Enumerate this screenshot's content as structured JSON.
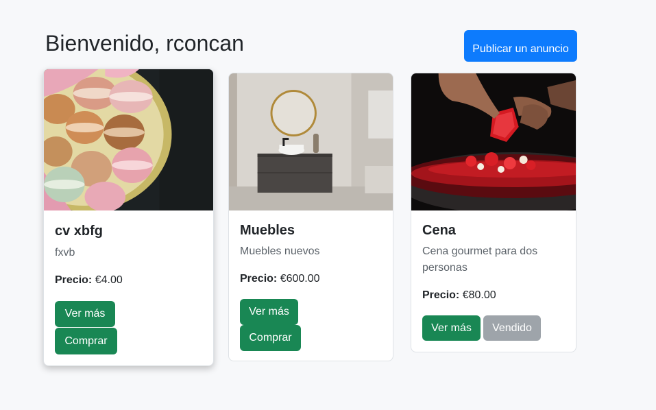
{
  "header": {
    "title": "Bienvenido, rconcan",
    "publish_label": "Publicar un anuncio"
  },
  "price_label": "Precio:",
  "cards": [
    {
      "title": "cv xbfg",
      "description": "fxvb",
      "price": "€4.00",
      "image": "macarons-photo",
      "buttons": [
        "Ver más",
        "Comprar"
      ]
    },
    {
      "title": "Muebles",
      "description": "Muebles nuevos",
      "price": "€600.00",
      "image": "bathroom-furniture-photo",
      "buttons": [
        "Ver más",
        "Comprar"
      ]
    },
    {
      "title": "Cena",
      "description_lines": [
        "Cena gourmet para dos",
        "personas"
      ],
      "price": "€80.00",
      "image": "gourmet-dish-photo",
      "buttons": [
        "Ver más",
        "Vendido"
      ]
    }
  ],
  "colors": {
    "primary": "#0d7bfd",
    "success": "#198754",
    "disabled": "#9ea4aa",
    "background": "#f7f8fa"
  }
}
